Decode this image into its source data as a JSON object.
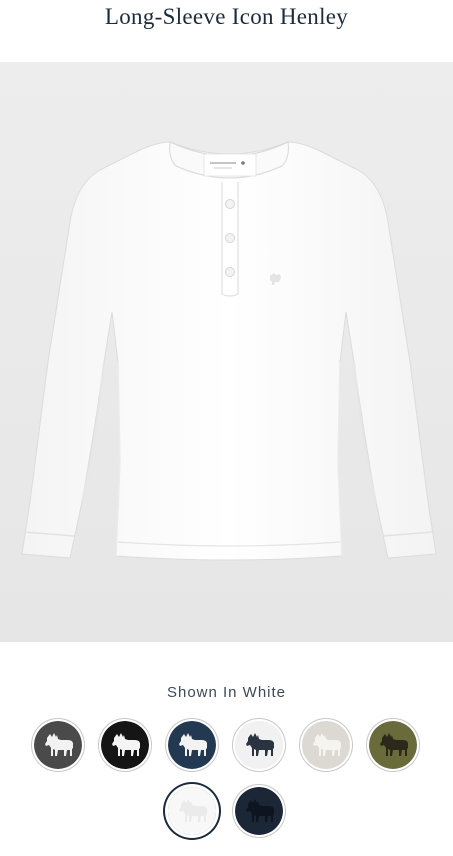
{
  "product": {
    "title": "Long-Sleeve Icon Henley"
  },
  "carousel": {
    "count": 6,
    "active_index": 0
  },
  "color_label": "Shown In White",
  "swatches": [
    {
      "name": "heather-charcoal",
      "bg": "#4a4a4a",
      "moose": "#f2f2f2",
      "selected": false
    },
    {
      "name": "black",
      "bg": "#151515",
      "moose": "#f4f4f4",
      "selected": false
    },
    {
      "name": "navy",
      "bg": "#233952",
      "moose": "#f2f2f2",
      "selected": false
    },
    {
      "name": "light-grey",
      "bg": "#f1f1f1",
      "moose": "#2a3440",
      "selected": false
    },
    {
      "name": "oatmeal",
      "bg": "#dcd9d2",
      "moose": "#f6f4ef",
      "selected": false
    },
    {
      "name": "olive",
      "bg": "#6a6b3a",
      "moose": "#2b2a1a",
      "selected": false
    },
    {
      "name": "white",
      "bg": "#f8f8f8",
      "moose": "#ebebeb",
      "selected": true
    },
    {
      "name": "dark-navy",
      "bg": "#1b2636",
      "moose": "#0e1520",
      "selected": false
    }
  ]
}
